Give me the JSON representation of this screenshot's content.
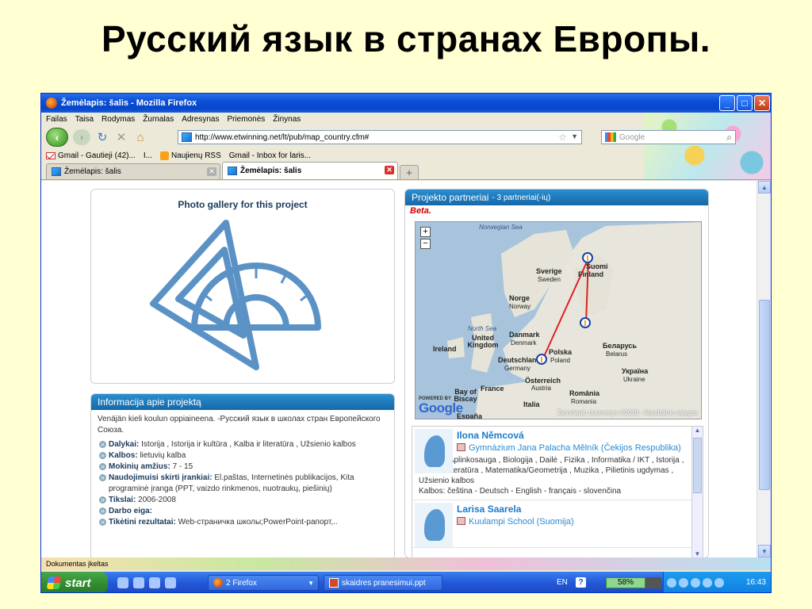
{
  "slide": {
    "title": "Русский язык в странах Европы."
  },
  "window": {
    "title": "Žemėlapis: šalis - Mozilla Firefox",
    "min": "_",
    "max": "□",
    "close": "✕"
  },
  "menu": [
    "Failas",
    "Taisa",
    "Rodymas",
    "Žurnalas",
    "Adresynas",
    "Priemonės",
    "Žinynas"
  ],
  "nav": {
    "url": "http://www.etwinning.net/lt/pub/map_country.cfm#",
    "search_placeholder": "Google"
  },
  "bookmarks": [
    "Gmail - Gautieji (42)...",
    "I...",
    "Naujienų RSS",
    "Gmail - Inbox for laris..."
  ],
  "tabs": [
    {
      "label": "Žemėlapis: šalis",
      "active": false
    },
    {
      "label": "Žemėlapis: šalis",
      "active": true
    }
  ],
  "photo": {
    "title": "Photo gallery for this project"
  },
  "info": {
    "header": "Informacija apie projektą",
    "intro": "Venäjän kieli koulun oppiaineena. -Русский язык в школах стран Европейского Союза.",
    "items": [
      {
        "key": "Dalykai:",
        "value": " Istorija , Istorija ir kultūra , Kalba ir literatūra , Užsienio kalbos"
      },
      {
        "key": "Kalbos:",
        "value": " lietuvių kalba"
      },
      {
        "key": "Mokinių amžius:",
        "value": " 7 - 15"
      },
      {
        "key": "Naudojimuisi skirti įrankiai:",
        "value": " El.paštas, Internetinės publikacijos, Kita programinė įranga (PPT, vaizdo rinkmenos, nuotraukų, piešinių)"
      },
      {
        "key": "Tikslai:",
        "value": " 2006-2008"
      },
      {
        "key": "Darbo eiga:",
        "value": ""
      },
      {
        "key": "Tikėtini rezultatai:",
        "value": " Web-страничка школы;PowerPoint-рапорт,.."
      }
    ]
  },
  "partners": {
    "header": "Projekto partneriai",
    "count": "- 3 partneriai(-ių)",
    "beta": "Beta.",
    "map": {
      "powered": "POWERED BY",
      "google": "Google",
      "copyright": "Žemėlapio duomenys ©2010 - Naudojimo sąlygos",
      "zoom_in": "+",
      "zoom_out": "−",
      "labels": {
        "norwegian_sea": "Norwegian Sea",
        "sverige": "Sverige",
        "sweden": "Sweden",
        "suomi": "Suomi",
        "finland": "Finland",
        "norge": "Norge",
        "norway": "Norway",
        "north_sea": "North Sea",
        "united_kingdom": "United Kingdom",
        "danmark": "Danmark",
        "denmark": "Denmark",
        "ireland": "Ireland",
        "polska": "Polska",
        "poland": "Poland",
        "belarus_ru": "Беларусь",
        "belarus": "Belarus",
        "deutschland": "Deutschland",
        "germany": "Germany",
        "ukraina_ru": "Україна",
        "ukraine": "Ukraine",
        "bay_of_biscay": "Bay of Biscay",
        "france": "France",
        "osterreich": "Österreich",
        "austria": "Austria",
        "romania": "România",
        "romania_en": "Romania",
        "italia": "Italia",
        "espana": "España"
      }
    },
    "list": [
      {
        "name": "Ilona Němcová",
        "school": "Gymnázium Jana Palacha Mělník (Čekijos Respublika)",
        "subjects": "Dalykai: Aplinkosauga , Biologija , Dailė , Fizika , Informatika / IKT , Istorija , Kalba ir literatūra , Matematika/Geometrija , Muzika , Pilietinis ugdymas , Užsienio kalbos",
        "languages": "Kalbos: čeština - Deutsch - English - français - slovenčina"
      },
      {
        "name": "Larisa Saarela",
        "school": "Kuulampi School (Suomija)",
        "subjects": "",
        "languages": ""
      }
    ]
  },
  "status": {
    "text": "Dokumentas įkeltas"
  },
  "taskbar": {
    "start": "start",
    "items": [
      "2 Firefox",
      "skaidres pranesimui.ppt"
    ],
    "lang": "EN",
    "help": "?",
    "battery": "58%",
    "clock": "16:43"
  },
  "colors": {
    "accent": "#1568a8",
    "link": "#1a7acc",
    "route": "#e02020"
  }
}
